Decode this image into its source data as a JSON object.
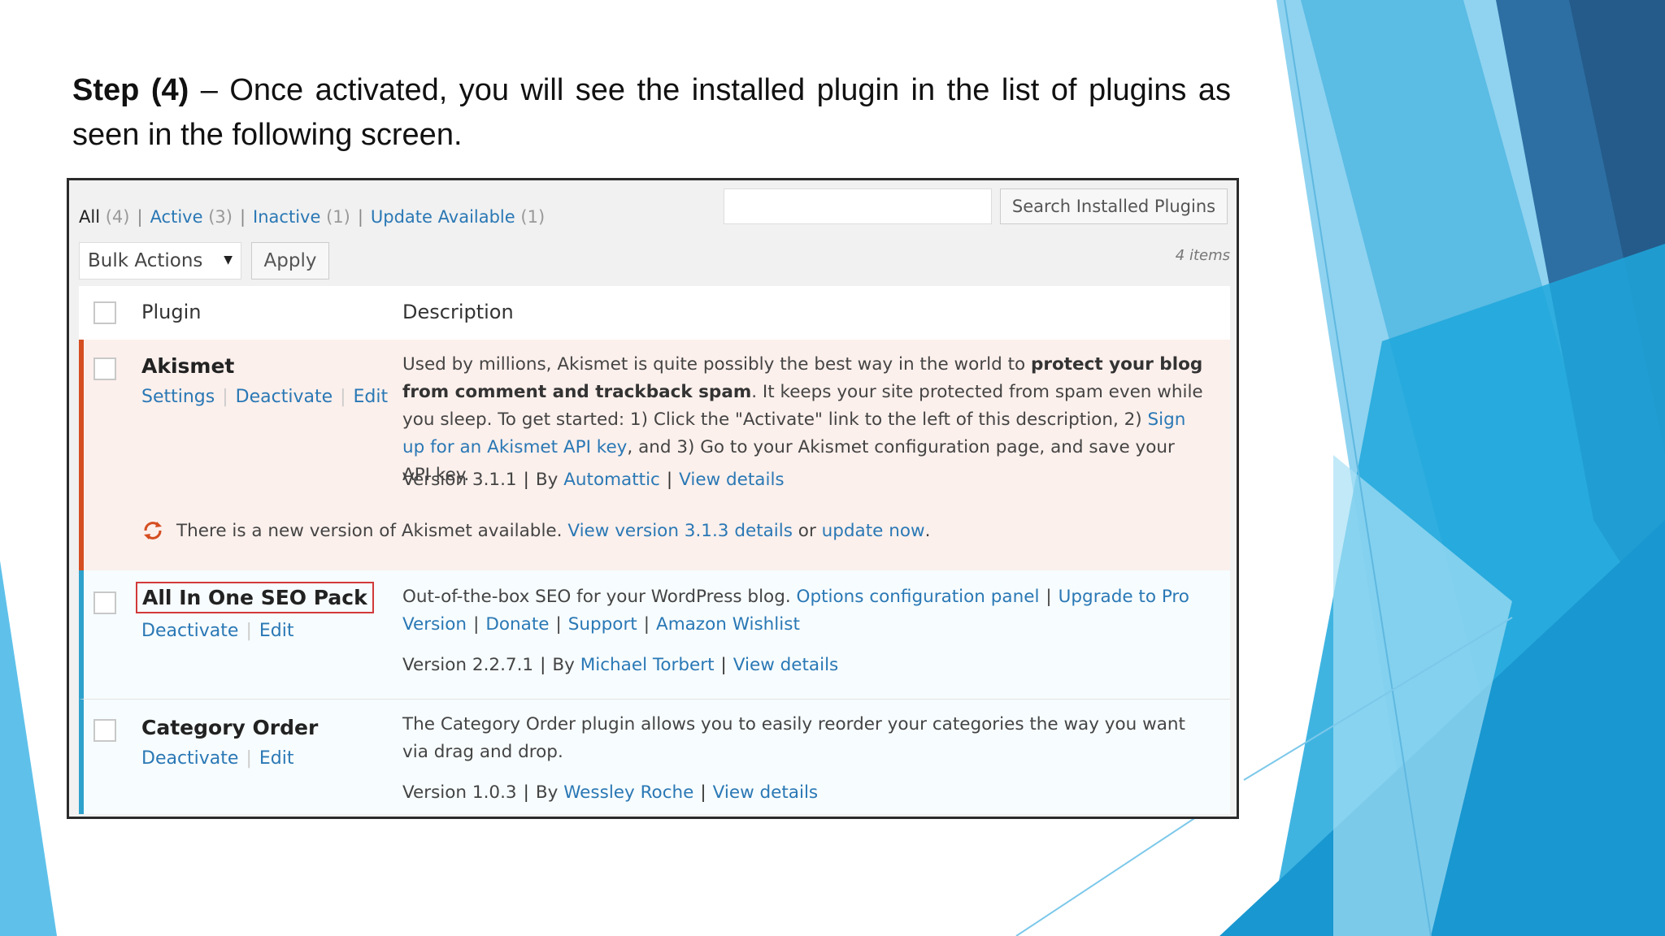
{
  "slide": {
    "step_label": "Step (4)",
    "step_text": " – Once activated, you will see the installed plugin in the list of plugins as seen in the following screen."
  },
  "filters": [
    {
      "label": "All",
      "count": "(4)",
      "current": true
    },
    {
      "label": "Active",
      "count": "(3)"
    },
    {
      "label": "Inactive",
      "count": "(1)"
    },
    {
      "label": "Update Available",
      "count": "(1)"
    }
  ],
  "search": {
    "value": "",
    "button_label": "Search Installed Plugins"
  },
  "bulk": {
    "selected": "Bulk Actions",
    "apply_label": "Apply",
    "item_count": "4 items"
  },
  "table": {
    "col_plugin": "Plugin",
    "col_description": "Description"
  },
  "plugins": [
    {
      "name": "Akismet",
      "actions": [
        "Settings",
        "Deactivate",
        "Edit"
      ],
      "desc_1": "Used by millions, Akismet is quite possibly the best way in the world to ",
      "desc_bold": "protect your blog from comment and trackback spam",
      "desc_2": ". It keeps your site protected from spam even while you sleep. To get started: 1) Click the \"Activate\" link to the left of this description, 2) ",
      "desc_link": "Sign up for an Akismet API key",
      "desc_3": ", and 3) Go to your Akismet configuration page, and save your API key.",
      "version": "Version 3.1.1",
      "by": "By",
      "author": "Automattic",
      "details": "View details",
      "notice_text": "There is a new version of Akismet available.",
      "notice_link1": "View version 3.1.3 details",
      "notice_or": "or",
      "notice_link2": "update now",
      "notice_end": "."
    },
    {
      "name": "All In One SEO Pack",
      "actions": [
        "Deactivate",
        "Edit"
      ],
      "desc_1": "Out-of-the-box SEO for your WordPress blog.",
      "links": [
        "Options configuration panel",
        "Upgrade to Pro Version",
        "Donate",
        "Support",
        "Amazon Wishlist"
      ],
      "version": "Version 2.2.7.1",
      "by": "By",
      "author": "Michael Torbert",
      "details": "View details"
    },
    {
      "name": "Category Order",
      "actions": [
        "Deactivate",
        "Edit"
      ],
      "desc_1": "The Category Order plugin allows you to easily reorder your categories the way you want via drag and drop.",
      "version": "Version 1.0.3",
      "by": "By",
      "author": "Wessley Roche",
      "details": "View details"
    }
  ],
  "colors": {
    "link": "#2a78b5",
    "update_border": "#d54e21",
    "active_border": "#2ea2cc",
    "highlight_box": "#d23a3a"
  },
  "icons": {
    "update": "update-refresh-icon",
    "dropdown": "caret-down-icon"
  }
}
